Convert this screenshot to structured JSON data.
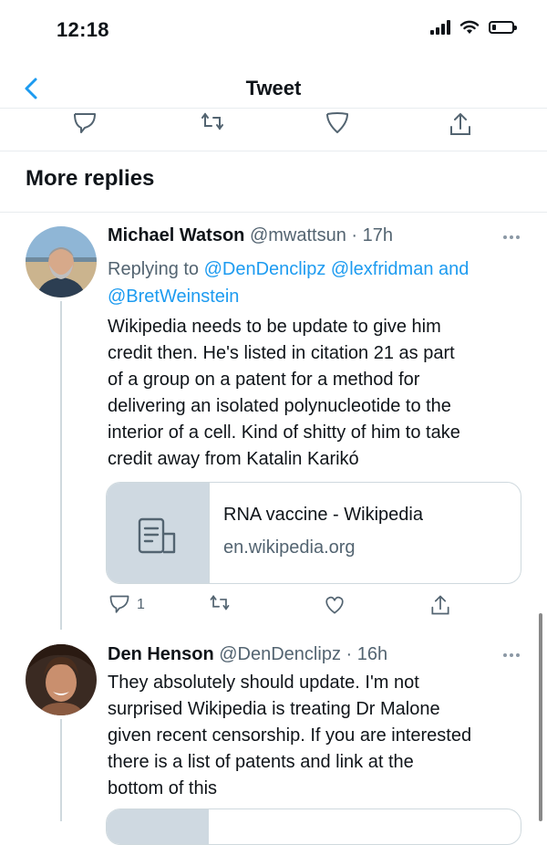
{
  "status_bar": {
    "time": "12:18"
  },
  "nav": {
    "title": "Tweet"
  },
  "section": {
    "title": "More replies"
  },
  "tweets": [
    {
      "name": "Michael Watson",
      "handle": "@mwattsun",
      "time": "· 17h",
      "replying_label": "Replying to",
      "replying_to": [
        "@DenDenclipz",
        "@lexfridman",
        "@BretWeinstein"
      ],
      "replying_and": "and",
      "body_lines": [
        "Wikipedia needs to be update to give him",
        "credit then. He's listed in citation 21 as part",
        "of a group on a patent for a method for",
        "delivering an isolated polynucleotide to the",
        "interior of a cell. Kind of shitty of him to take",
        "credit away from Katalin Karikó"
      ],
      "card": {
        "title": "RNA vaccine - Wikipedia",
        "domain": "en.wikipedia.org"
      },
      "reply_count": "1"
    },
    {
      "name": "Den Henson",
      "handle": "@DenDenclipz",
      "time": "· 16h",
      "body_lines": [
        "They absolutely should update. I'm not",
        "surprised Wikipedia is treating Dr Malone",
        "given recent censorship. If you are interested",
        "there is a list of patents and link at the",
        "bottom of this"
      ]
    }
  ],
  "icons": {
    "back": "chevron-left-icon",
    "reply": "reply-icon",
    "retweet": "retweet-icon",
    "like": "heart-icon",
    "share": "share-icon",
    "more": "more-icon",
    "card": "article-icon"
  },
  "colors": {
    "accent": "#1d9bf0",
    "text": "#0f1419",
    "muted": "#536471",
    "border": "#cfd9de"
  }
}
